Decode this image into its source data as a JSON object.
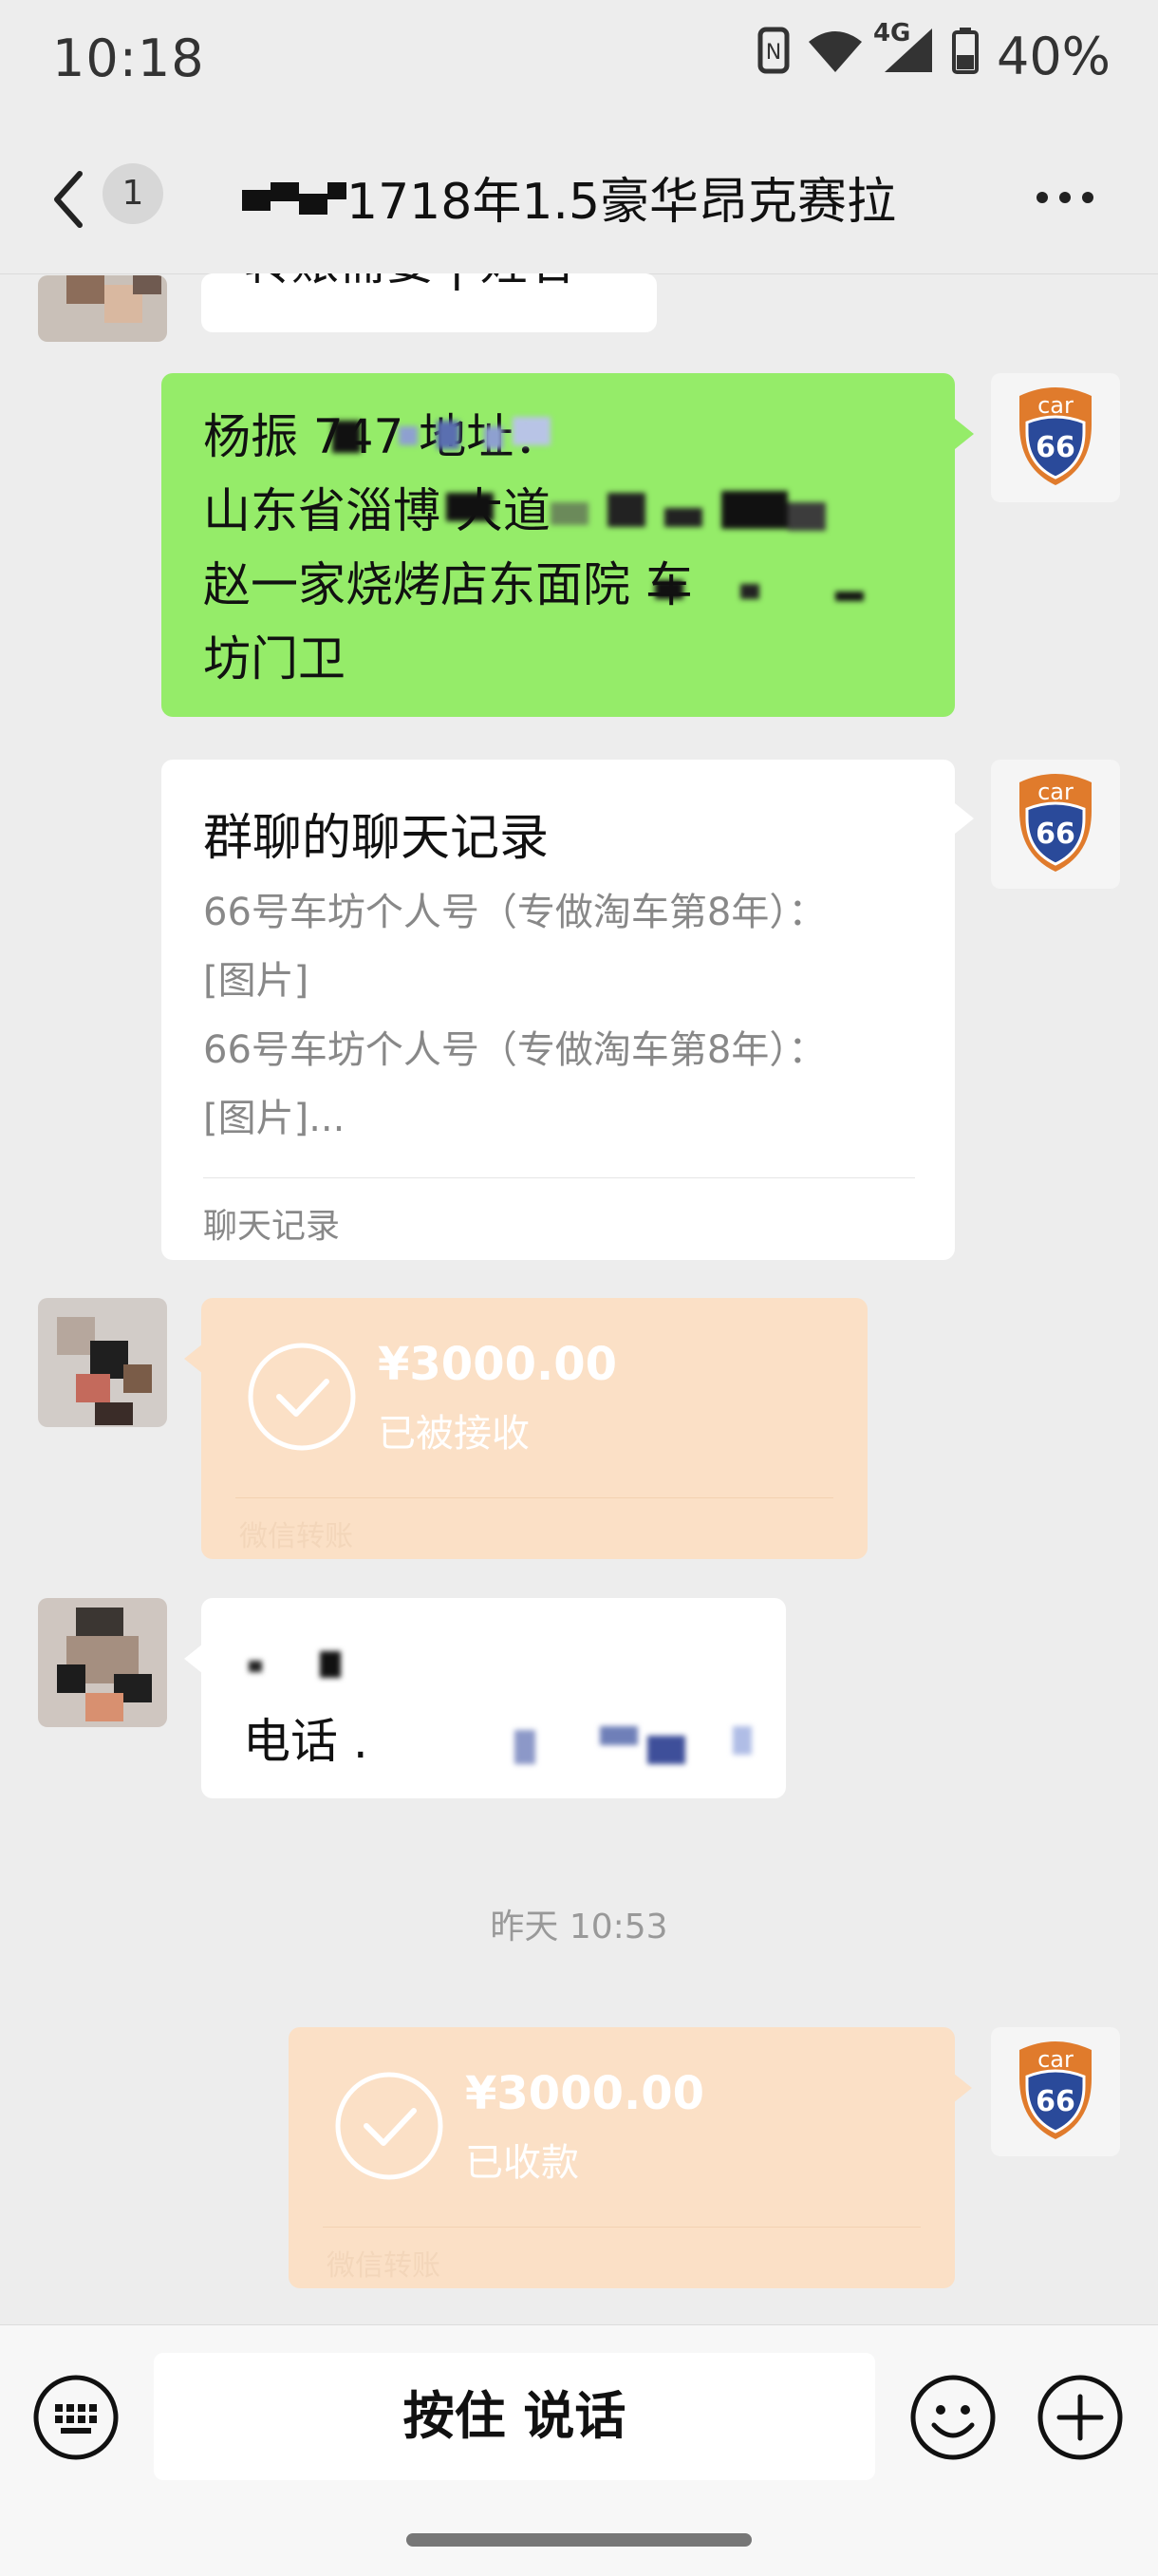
{
  "status_bar": {
    "time": "10:18",
    "network": "4G",
    "battery": "40%"
  },
  "header": {
    "back_badge": "1",
    "title": "1718年1.5豪华昂克赛拉"
  },
  "messages": {
    "partial_top": "转账需要 | 姓名",
    "address_line1": "杨振   747  地址：",
    "address_line2": "山东省淄博         大道",
    "address_line3": "赵一家烧烤店东面院        车",
    "address_line4": "坊门卫",
    "forward_title": "群聊的聊天记录",
    "forward_line1": "66号车坊个人号（专做淘车第8年）：",
    "forward_line2": "[图片]",
    "forward_line3": "66号车坊个人号（专做淘车第8年）：",
    "forward_line4": "[图片]...",
    "forward_footer": "聊天记录",
    "transfer1_amount": "¥3000.00",
    "transfer1_status": "已被接收",
    "transfer1_footer": "微信转账",
    "phone_label": "电话 .",
    "timestamp": "昨天 10:53",
    "transfer2_amount": "¥3000.00",
    "transfer2_status": "已收款",
    "transfer2_footer": "微信转账"
  },
  "avatar": {
    "car_text": "car",
    "car_number": "66"
  },
  "input_bar": {
    "hold_to_talk": "按住 说话"
  },
  "colors": {
    "sent_bubble": "#95ec69",
    "received_bubble": "#ffffff",
    "transfer_bubble": "#fbe0c6",
    "background": "#ededed"
  }
}
